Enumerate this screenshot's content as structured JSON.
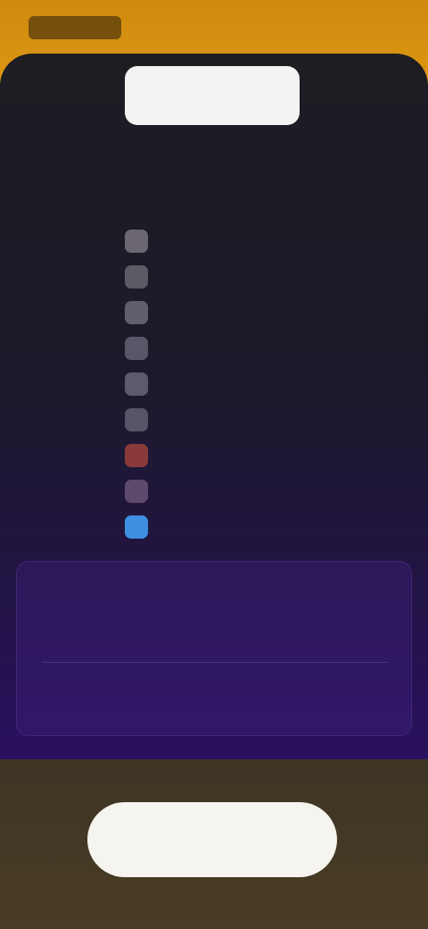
{
  "header": {
    "back_label": ""
  },
  "hero": {
    "badge": "",
    "subtitle": ""
  },
  "features": [
    {
      "icon": "star-icon",
      "label": "",
      "color": "#6b6670"
    },
    {
      "icon": "square-icon",
      "label": "",
      "color": "#5d5a66"
    },
    {
      "icon": "square-icon",
      "label": "",
      "color": "#625e6e"
    },
    {
      "icon": "square-icon",
      "label": "",
      "color": "#5a5668"
    },
    {
      "icon": "square-icon",
      "label": "",
      "color": "#5e5a6c"
    },
    {
      "icon": "square-icon",
      "label": "",
      "color": "#595467"
    },
    {
      "icon": "flame-icon",
      "label": "",
      "color": "#8a3a3a"
    },
    {
      "icon": "square-icon",
      "label": "",
      "color": "#5e4a6c"
    },
    {
      "icon": "globe-icon",
      "label": "",
      "color": "#3f8fe0"
    }
  ],
  "plans": {
    "monthly": {
      "name": "",
      "price": "",
      "note": ""
    },
    "yearly": {
      "name": "",
      "price": ""
    }
  },
  "footer": {
    "note": "",
    "continue_label": ""
  },
  "colors": {
    "top_band": "#d89210",
    "sheet_top": "#1d1d22",
    "sheet_bottom": "#2a1160",
    "footer": "#4a3d25",
    "button": "#f6f4ee"
  }
}
